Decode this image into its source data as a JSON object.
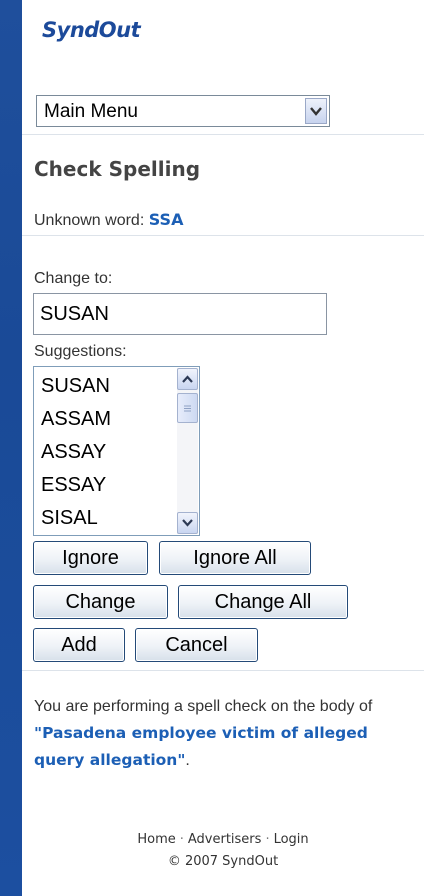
{
  "brand": {
    "logo_text": "SyndOut"
  },
  "menu": {
    "selected": "Main Menu"
  },
  "page": {
    "title": "Check Spelling",
    "unknown_label": "Unknown word:",
    "unknown_word": "SSA"
  },
  "form": {
    "change_to_label": "Change to:",
    "change_to_value": "SUSAN",
    "suggestions_label": "Suggestions:",
    "suggestions": [
      "SUSAN",
      "ASSAM",
      "ASSAY",
      "ESSAY",
      "SISAL"
    ]
  },
  "buttons": {
    "ignore": "Ignore",
    "ignore_all": "Ignore All",
    "change": "Change",
    "change_all": "Change All",
    "add": "Add",
    "cancel": "Cancel"
  },
  "info": {
    "prefix": "You are performing a spell check on the body of ",
    "article_title": "\"Pasadena employee victim of alleged query allegation\"",
    "suffix": "."
  },
  "footer": {
    "links": [
      "Home",
      "Advertisers",
      "Login"
    ],
    "copyright": "© 2007 SyndOut"
  },
  "colors": {
    "background_blue": "#1f4f9c",
    "brand_blue": "#1c4a9a",
    "link_blue": "#1c5fb5"
  }
}
